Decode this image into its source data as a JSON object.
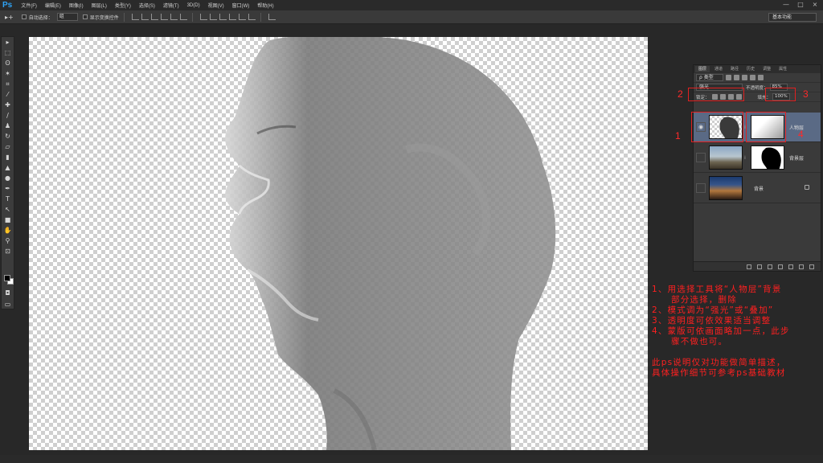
{
  "app": {
    "logo": "Ps"
  },
  "menu": [
    "文件(F)",
    "编辑(E)",
    "图像(I)",
    "图层(L)",
    "类型(Y)",
    "选择(S)",
    "滤镜(T)",
    "3D(D)",
    "视图(V)",
    "窗口(W)",
    "帮助(H)"
  ],
  "window_controls": [
    "—",
    "□",
    "×"
  ],
  "options": {
    "tool_icon": "move-icon",
    "auto_select_label": "自动选择：",
    "auto_select_value": "组",
    "show_transform_label": "显示变换控件",
    "workspace": "基本功能"
  },
  "layers_panel": {
    "tabs": [
      "图层",
      "通道",
      "路径",
      "历史",
      "调整",
      "属性"
    ],
    "filter_label": "ρ 类型",
    "blend_mode": "强光",
    "opacity_label": "不透明度：",
    "opacity_value": "85%",
    "lock_label": "锁定：",
    "fill_label": "填充：",
    "fill_value": "100%",
    "layers": [
      {
        "name": "人物层",
        "selected": true,
        "visible": true,
        "thumb": "checker-portrait",
        "mask": "gradient-mask"
      },
      {
        "name": "背景层",
        "selected": false,
        "visible": false,
        "thumb": "city-day",
        "mask": "portrait-mask"
      },
      {
        "name": "背景",
        "selected": false,
        "visible": false,
        "thumb": "city-night",
        "mask": null,
        "locked": true
      }
    ]
  },
  "annotations": {
    "markers": [
      "1",
      "2",
      "3",
      "4"
    ],
    "notes": [
      "1、用选择工具将“人物层”背景",
      "部分选择，删除",
      "2、模式调为“强光”或“叠加”",
      "3、透明度可依效果适当调整",
      "4、蒙版可依画面略加一点，此步",
      "骤不做也可。"
    ],
    "footer": [
      "此ps说明仅对功能做简单描述，",
      "具体操作细节可参考ps基础教材"
    ],
    "color": "#ff2020"
  },
  "canvas": {
    "background": "transparent-checkerboard",
    "subject": "gray-silhouette-portrait"
  }
}
